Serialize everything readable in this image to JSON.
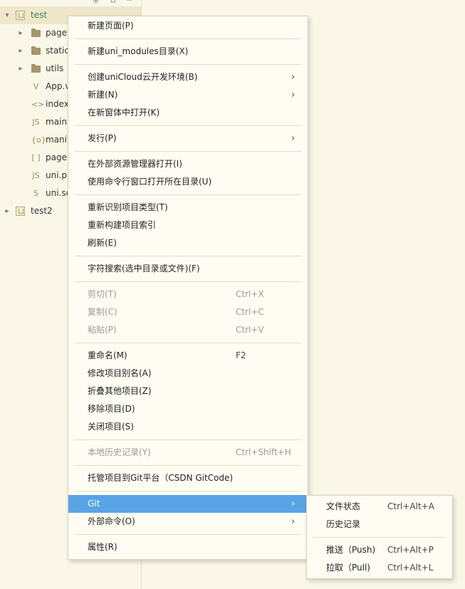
{
  "tree": {
    "items": [
      {
        "label": "test",
        "icon": "project-icon",
        "chevron": "chevron-down",
        "selected": true
      },
      {
        "label": "page",
        "icon": "folder-icon",
        "chevron": "chevron-right"
      },
      {
        "label": "static",
        "icon": "folder-icon",
        "chevron": "chevron-right"
      },
      {
        "label": "utils",
        "icon": "folder-icon",
        "chevron": "chevron-right"
      },
      {
        "label": "App.v",
        "icon": "vue-file-icon",
        "glyph": "V"
      },
      {
        "label": "index",
        "icon": "html-file-icon",
        "glyph": "<>"
      },
      {
        "label": "main.",
        "icon": "js-file-icon",
        "glyph": "JS"
      },
      {
        "label": "manif",
        "icon": "json-file-icon",
        "glyph": "{o}"
      },
      {
        "label": "page",
        "icon": "json-bracket-icon",
        "glyph": "[ ]"
      },
      {
        "label": "uni.p",
        "icon": "js-file-icon",
        "glyph": "JS"
      },
      {
        "label": "uni.sc",
        "icon": "scss-file-icon",
        "glyph": "S"
      },
      {
        "label": "test2",
        "icon": "project-icon",
        "chevron": "chevron-right"
      }
    ],
    "selected_color": "#2e8b57"
  },
  "menu": {
    "items": [
      {
        "label": "新建页面(P)"
      },
      {
        "sep": true
      },
      {
        "label": "新建uni_modules目录(X)"
      },
      {
        "sep": true
      },
      {
        "label": "创建uniCloud云开发环境(B)",
        "submenu": true
      },
      {
        "label": "新建(N)",
        "submenu": true
      },
      {
        "label": "在新窗体中打开(K)"
      },
      {
        "sep": true
      },
      {
        "label": "发行(P)",
        "submenu": true
      },
      {
        "sep": true
      },
      {
        "label": "在外部资源管理器打开(I)"
      },
      {
        "label": "使用命令行窗口打开所在目录(U)"
      },
      {
        "sep": true
      },
      {
        "label": "重新识别项目类型(T)"
      },
      {
        "label": "重新构建项目索引"
      },
      {
        "label": "刷新(E)"
      },
      {
        "sep": true
      },
      {
        "label": "字符搜索(选中目录或文件)(F)"
      },
      {
        "sep": true
      },
      {
        "label": "剪切(T)",
        "shortcut": "Ctrl+X",
        "disabled": true
      },
      {
        "label": "复制(C)",
        "shortcut": "Ctrl+C",
        "disabled": true
      },
      {
        "label": "粘贴(P)",
        "shortcut": "Ctrl+V",
        "disabled": true
      },
      {
        "sep": true
      },
      {
        "label": "重命名(M)",
        "shortcut": "F2"
      },
      {
        "label": "修改项目别名(A)"
      },
      {
        "label": "折叠其他项目(Z)"
      },
      {
        "label": "移除项目(D)"
      },
      {
        "label": "关闭项目(S)"
      },
      {
        "sep": true
      },
      {
        "label": "本地历史记录(Y)",
        "shortcut": "Ctrl+Shift+H",
        "disabled": true
      },
      {
        "sep": true
      },
      {
        "label": "托管项目到Git平台（CSDN GitCode)"
      },
      {
        "sep": true
      },
      {
        "label": "Git",
        "submenu": true,
        "active": true
      },
      {
        "label": "外部命令(O)",
        "submenu": true
      },
      {
        "sep": true
      },
      {
        "label": "属性(R)"
      }
    ],
    "arrow_glyph": "›",
    "active_color": "#5aa4e6"
  },
  "submenu": {
    "items": [
      {
        "label": "文件状态",
        "shortcut": "Ctrl+Alt+A"
      },
      {
        "label": "历史记录"
      },
      {
        "sep": true
      },
      {
        "label": "推送（Push)",
        "shortcut": "Ctrl+Alt+P"
      },
      {
        "label": "拉取（Pull)",
        "shortcut": "Ctrl+Alt+L"
      }
    ]
  }
}
